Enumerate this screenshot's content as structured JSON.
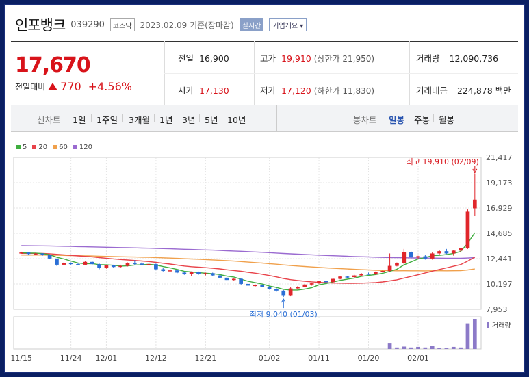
{
  "header": {
    "company": "인포뱅크",
    "code": "039290",
    "market": "코스닥",
    "date_text": "2023.02.09",
    "basis": "기준(장마감)",
    "realtime": "실시간",
    "corp_info": "기업개요"
  },
  "price": {
    "current": "17,670",
    "change_label": "전일대비",
    "change": "770",
    "change_pct": "+4.56%"
  },
  "stats": {
    "prev_label": "전일",
    "prev": "16,900",
    "high_label": "고가",
    "high": "19,910",
    "upper_limit": "(상한가 21,950)",
    "volume_label": "거래량",
    "volume": "12,090,736",
    "open_label": "시가",
    "open": "17,130",
    "low_label": "저가",
    "low": "17,120",
    "lower_limit": "(하한가 11,830)",
    "amount_label": "거래대금",
    "amount": "224,878",
    "amount_unit": "백만"
  },
  "tabs": {
    "line_label": "선차트",
    "periods": [
      "1일",
      "1주일",
      "3개월",
      "1년",
      "3년",
      "5년",
      "10년"
    ],
    "candle_label": "봉차트",
    "candle_periods": [
      "일봉",
      "주봉",
      "월봉"
    ],
    "selected": "일봉"
  },
  "legend": [
    {
      "label": "5",
      "color": "#3fae3f"
    },
    {
      "label": "20",
      "color": "#e8434a"
    },
    {
      "label": "60",
      "color": "#f0a04b"
    },
    {
      "label": "120",
      "color": "#9a6ad0"
    }
  ],
  "chart_data": {
    "type": "candlestick",
    "y_ticks": [
      "21,417",
      "19,173",
      "16,929",
      "14,685",
      "12,441",
      "10,197",
      "7,953"
    ],
    "ylim": [
      7953,
      21417
    ],
    "x_ticks": [
      "11/15",
      "11/24",
      "12/01",
      "12/12",
      "12/21",
      "01/02",
      "01/11",
      "01/20",
      "02/01"
    ],
    "annotations": {
      "high": "최고 19,910 (02/09)",
      "low": "최저 9,040 (01/03)"
    },
    "volume_label": "거래량",
    "candles": [
      [
        12970,
        13050,
        12900,
        12980
      ],
      [
        12980,
        12990,
        12800,
        12850
      ],
      [
        12850,
        12950,
        12800,
        12900
      ],
      [
        12900,
        12920,
        12700,
        12750
      ],
      [
        12750,
        12780,
        12400,
        12450
      ],
      [
        12450,
        12300,
        11800,
        11900
      ],
      [
        11900,
        12100,
        11850,
        12050
      ],
      [
        12050,
        12100,
        11900,
        11950
      ],
      [
        11950,
        12050,
        11850,
        11900
      ],
      [
        11900,
        12200,
        11850,
        12150
      ],
      [
        12150,
        12200,
        11900,
        11950
      ],
      [
        11950,
        12000,
        11500,
        11600
      ],
      [
        11600,
        11900,
        11550,
        11850
      ],
      [
        11850,
        11900,
        11650,
        11700
      ],
      [
        11700,
        11900,
        11600,
        11800
      ],
      [
        11800,
        12100,
        11750,
        12050
      ],
      [
        12050,
        12300,
        11900,
        12000
      ],
      [
        12000,
        12100,
        11850,
        11900
      ],
      [
        11900,
        12000,
        11800,
        11950
      ],
      [
        11950,
        12000,
        11400,
        11500
      ],
      [
        11500,
        11600,
        11300,
        11350
      ],
      [
        11350,
        11500,
        11250,
        11400
      ],
      [
        11400,
        11450,
        11150,
        11200
      ],
      [
        11200,
        11300,
        11000,
        11100
      ],
      [
        11100,
        11300,
        10900,
        11250
      ],
      [
        11250,
        11300,
        11000,
        11050
      ],
      [
        11050,
        11200,
        10950,
        11150
      ],
      [
        11150,
        11200,
        10900,
        10950
      ],
      [
        10950,
        11050,
        10700,
        10750
      ],
      [
        10750,
        10800,
        10500,
        10550
      ],
      [
        10550,
        10700,
        10450,
        10650
      ],
      [
        10650,
        10700,
        10100,
        10200
      ],
      [
        10200,
        10300,
        10000,
        10050
      ],
      [
        10050,
        10150,
        9950,
        10100
      ],
      [
        10100,
        10150,
        9900,
        9950
      ],
      [
        9950,
        10000,
        9700,
        9750
      ],
      [
        9750,
        9850,
        9500,
        9600
      ],
      [
        9600,
        9650,
        9040,
        9200
      ],
      [
        9200,
        9900,
        9100,
        9800
      ],
      [
        9800,
        10000,
        9700,
        9950
      ],
      [
        9950,
        10200,
        9900,
        10150
      ],
      [
        10150,
        10300,
        10050,
        10250
      ],
      [
        10250,
        10500,
        10200,
        10450
      ],
      [
        10450,
        10500,
        10300,
        10350
      ],
      [
        10350,
        10700,
        10300,
        10650
      ],
      [
        10650,
        10900,
        10600,
        10850
      ],
      [
        10850,
        10900,
        10700,
        10800
      ],
      [
        10800,
        11000,
        10750,
        10950
      ],
      [
        10950,
        11150,
        10900,
        11100
      ],
      [
        11100,
        11200,
        11000,
        11050
      ],
      [
        11050,
        11300,
        11000,
        11250
      ],
      [
        11250,
        11400,
        11200,
        11350
      ],
      [
        11350,
        12900,
        11300,
        11800
      ],
      [
        11800,
        12100,
        11750,
        12050
      ],
      [
        12050,
        13300,
        11900,
        13000
      ],
      [
        13000,
        13100,
        12500,
        12550
      ],
      [
        12550,
        12700,
        12400,
        12650
      ],
      [
        12650,
        12800,
        12350,
        12450
      ],
      [
        12450,
        13000,
        12350,
        12900
      ],
      [
        12900,
        13200,
        12800,
        13100
      ],
      [
        13100,
        13300,
        12850,
        12900
      ],
      [
        12900,
        13200,
        12700,
        13150
      ],
      [
        13150,
        13400,
        13000,
        13350
      ],
      [
        13350,
        16800,
        13300,
        16600
      ],
      [
        16900,
        19910,
        16200,
        17670
      ]
    ],
    "volumes": [
      0,
      0,
      0,
      0,
      0,
      0,
      0,
      0,
      0,
      0,
      0,
      0,
      0,
      0,
      0,
      0,
      0,
      0,
      0,
      0,
      0,
      0,
      0,
      0,
      0,
      0,
      0,
      0,
      0,
      0,
      0,
      0,
      0,
      0,
      0,
      0,
      0,
      0,
      0,
      0,
      0,
      0,
      0,
      0,
      0,
      0,
      0,
      0,
      0,
      0,
      0,
      0,
      0.18,
      0.05,
      0.08,
      0.05,
      0.07,
      0.05,
      0.1,
      0.04,
      0.04,
      0.07,
      0.05,
      0.85,
      1.0
    ]
  }
}
